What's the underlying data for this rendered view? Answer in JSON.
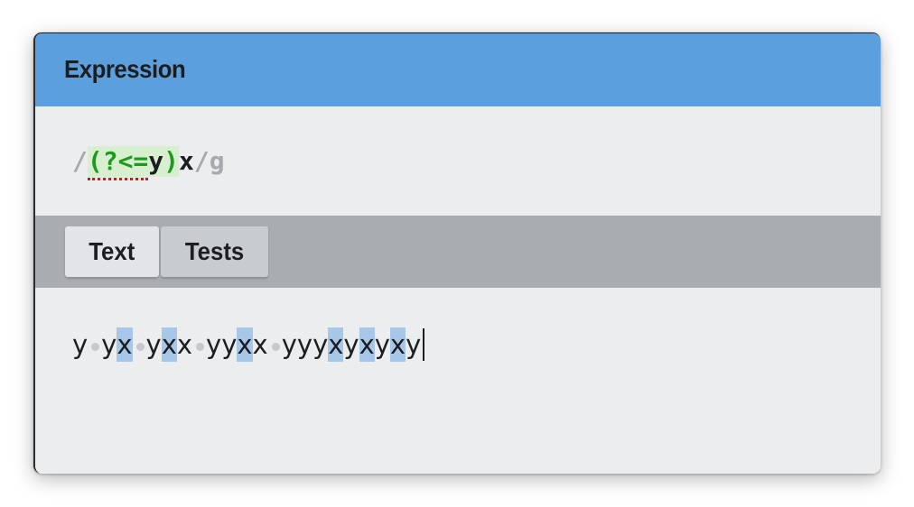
{
  "header": {
    "title": "Expression"
  },
  "expression": {
    "open_delim": "/",
    "group_open": "(?<=",
    "group_inner": "y",
    "group_close": ")",
    "literal": "x",
    "close_delim": "/",
    "flags": "g"
  },
  "tabs": [
    {
      "label": "Text",
      "selected": true
    },
    {
      "label": "Tests",
      "selected": false
    }
  ],
  "test_text": {
    "value": "y yx yxx yyxx yyyxyxyxy",
    "match_color": "#a7c7e9",
    "segments": [
      {
        "t": "y",
        "m": false
      },
      {
        "t": " ",
        "m": false
      },
      {
        "t": "y",
        "m": false
      },
      {
        "t": "x",
        "m": true
      },
      {
        "t": " ",
        "m": false
      },
      {
        "t": "y",
        "m": false
      },
      {
        "t": "x",
        "m": true
      },
      {
        "t": "x",
        "m": false
      },
      {
        "t": " ",
        "m": false
      },
      {
        "t": "y",
        "m": false
      },
      {
        "t": "y",
        "m": false
      },
      {
        "t": "x",
        "m": true
      },
      {
        "t": "x",
        "m": false
      },
      {
        "t": " ",
        "m": false
      },
      {
        "t": "y",
        "m": false
      },
      {
        "t": "y",
        "m": false
      },
      {
        "t": "y",
        "m": false
      },
      {
        "t": "x",
        "m": true
      },
      {
        "t": "y",
        "m": false
      },
      {
        "t": "x",
        "m": true
      },
      {
        "t": "y",
        "m": false
      },
      {
        "t": "x",
        "m": true
      },
      {
        "t": "y",
        "m": false
      }
    ]
  },
  "colors": {
    "header_bg": "#5b9fdc",
    "group_token": "#1d9a1d",
    "group_bg": "#d7efcf",
    "error_underline": "#cc1c1c",
    "delimiter": "#a6a9ae"
  }
}
